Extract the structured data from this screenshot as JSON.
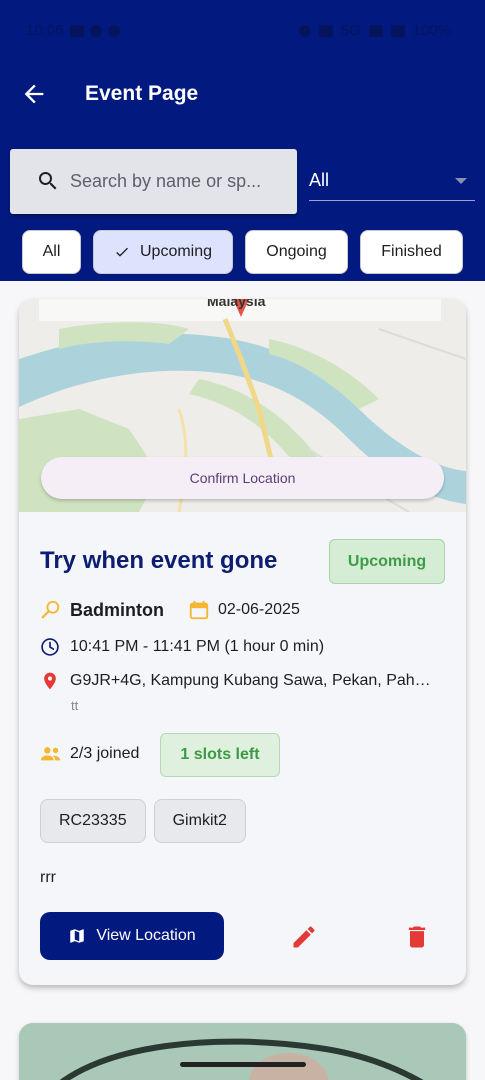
{
  "status_bar": {
    "time": "10:06",
    "network": "5G",
    "battery": "100%"
  },
  "header": {
    "title": "Event Page",
    "back_icon": "arrow-left-icon"
  },
  "search": {
    "placeholder": "Search by name or sp...",
    "value": ""
  },
  "sport_filter": {
    "selected": "All"
  },
  "status_filters": [
    {
      "label": "All",
      "selected": false
    },
    {
      "label": "Upcoming",
      "selected": true
    },
    {
      "label": "Ongoing",
      "selected": false
    },
    {
      "label": "Finished",
      "selected": false
    }
  ],
  "event": {
    "map_label": "Malaysia",
    "confirm_location": "Confirm Location",
    "title": "Try when event gone",
    "status": "Upcoming",
    "sport": "Badminton",
    "date": "02-06-2025",
    "time": "10:41 PM - 11:41 PM (1 hour 0 min)",
    "location": "G9JR+4G, Kampung Kubang Sawa, Pekan, Pah…",
    "location_note": "tt",
    "joined": "2/3 joined",
    "slots_left": "1 slots left",
    "tags": [
      "RC23335",
      "Gimkit2"
    ],
    "description": "rrr",
    "view_location": "View Location"
  },
  "colors": {
    "primary": "#021a80",
    "accent_green": "#3d9c45",
    "icon_orange": "#f5b731",
    "icon_red": "#e53935"
  }
}
